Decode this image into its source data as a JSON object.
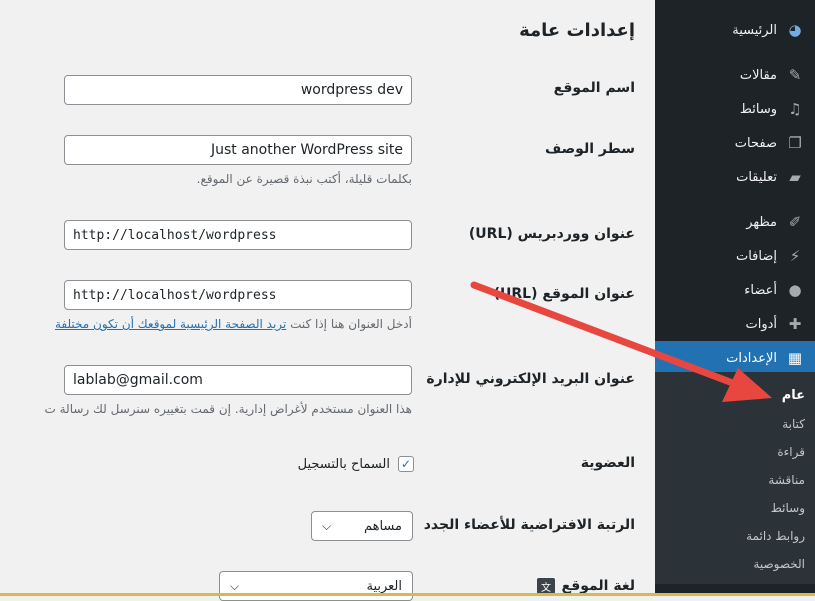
{
  "sidebar": {
    "items": [
      {
        "label": "الرئيسية",
        "icon": "dashboard-icon"
      },
      {
        "label": "مقالات",
        "icon": "pin-icon"
      },
      {
        "label": "وسائط",
        "icon": "media-icon"
      },
      {
        "label": "صفحات",
        "icon": "pages-icon"
      },
      {
        "label": "تعليقات",
        "icon": "comments-icon"
      },
      {
        "label": "مظهر",
        "icon": "appearance-icon"
      },
      {
        "label": "إضافات",
        "icon": "plugins-icon"
      },
      {
        "label": "أعضاء",
        "icon": "users-icon"
      },
      {
        "label": "أدوات",
        "icon": "tools-icon"
      },
      {
        "label": "الإعدادات",
        "icon": "settings-icon"
      }
    ],
    "submenu": [
      "عام",
      "كتابة",
      "قراءة",
      "مناقشة",
      "وسائط",
      "روابط دائمة",
      "الخصوصية"
    ]
  },
  "main": {
    "heading": "إعدادات عامة",
    "site_title": {
      "label": "اسم الموقع",
      "value": "wordpress dev"
    },
    "tagline": {
      "label": "سطر الوصف",
      "value": "Just another WordPress site",
      "desc": "بكلمات قليلة، أكتب نبذة قصيرة عن الموقع."
    },
    "wp_url": {
      "label": "عنوان ووردبريس (URL)",
      "value": "http://localhost/wordpress"
    },
    "site_url": {
      "label": "عنوان الموقع (URL)",
      "value": "http://localhost/wordpress",
      "desc_prefix": "أدخل العنوان هنا إذا كنت ",
      "desc_link": "تريد الصفحة الرئيسية لموقعك أن تكون مختلفة"
    },
    "admin_email": {
      "label": "عنوان البريد الإلكتروني للإدارة",
      "value": "lablab@gmail.com",
      "desc": "هذا العنوان مستخدم لأغراض إدارية. إن قمت بتغييره سنرسل لك رسالة ت"
    },
    "membership": {
      "label": "العضوية",
      "checkbox_label": "السماح بالتسجيل",
      "checked": true
    },
    "default_role": {
      "label": "الرتبة الافتراضية للأعضاء الجدد",
      "value": "مساهم"
    },
    "site_language": {
      "label": "لغة الموقع",
      "value": "العربية"
    }
  },
  "colors": {
    "sidebar": "#1d2327",
    "accent": "#2271b1",
    "arrow": "#e8473f"
  }
}
